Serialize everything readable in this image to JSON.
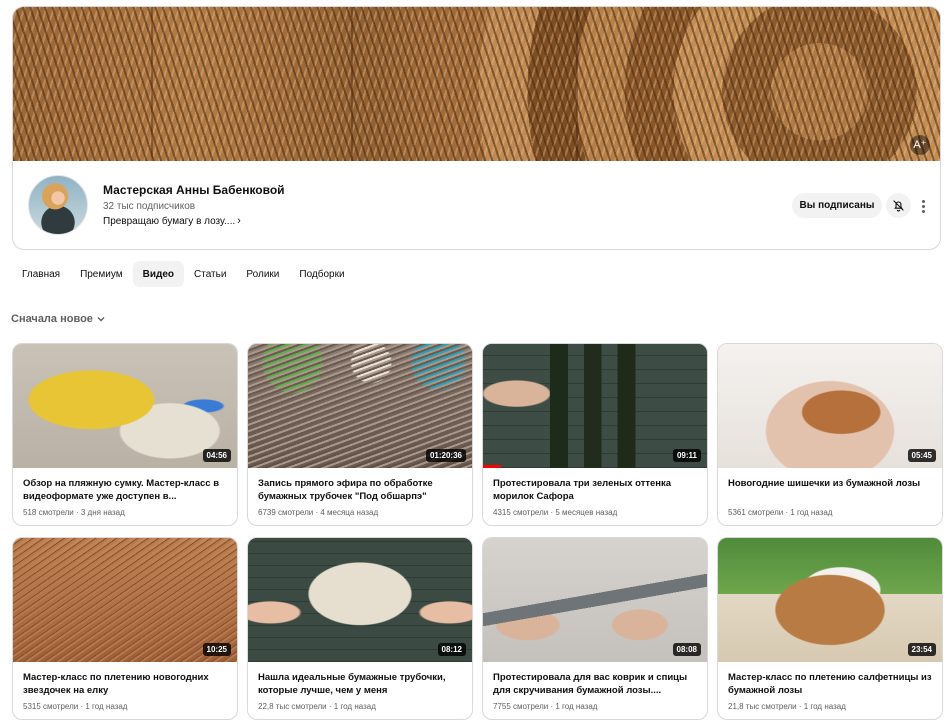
{
  "channel": {
    "name": "Мастерская Анны Бабенковой",
    "subscribers": "32 тыс подписчиков",
    "description": "Превращаю бумагу в лозу....",
    "subscribed_label": "Вы подписаны"
  },
  "tabs": [
    {
      "label": "Главная",
      "active": false
    },
    {
      "label": "Премиум",
      "active": false
    },
    {
      "label": "Видео",
      "active": true
    },
    {
      "label": "Статьи",
      "active": false
    },
    {
      "label": "Ролики",
      "active": false
    },
    {
      "label": "Подборки",
      "active": false
    }
  ],
  "sort": {
    "label": "Сначала новое"
  },
  "videos": [
    {
      "title": "Обзор на пляжную сумку. Мастер-класс в видеоформате уже доступен в...",
      "meta": "518 смотрели · 3 дня назад",
      "duration": "04:56",
      "watched": 0
    },
    {
      "title": "Запись прямого эфира по обработке бумажных трубочек \"Под обшарпэ\"",
      "meta": "6739 смотрели · 4 месяца назад",
      "duration": "01:20:36",
      "watched": 0
    },
    {
      "title": "Протестировала три зеленых оттенка морилок Сафора",
      "meta": "4315 смотрели · 5 месяцев назад",
      "duration": "09:11",
      "watched": 0.08
    },
    {
      "title": "Новогодние шишечки из бумажной лозы",
      "meta": "5361 смотрели · 1 год назад",
      "duration": "05:45",
      "watched": 0
    },
    {
      "title": "Мастер-класс по плетению новогодних звездочек на елку",
      "meta": "5315 смотрели · 1 год назад",
      "duration": "10:25",
      "watched": 0
    },
    {
      "title": "Нашла идеальные бумажные трубочки, которые лучше, чем у меня",
      "meta": "22,8 тыс смотрели · 1 год назад",
      "duration": "08:12",
      "watched": 0
    },
    {
      "title": "Протестировала для вас коврик и спицы для скручивания бумажной лозы....",
      "meta": "7755 смотрели · 1 год назад",
      "duration": "08:08",
      "watched": 0
    },
    {
      "title": "Мастер-класс по плетению салфетницы из бумажной лозы",
      "meta": "21,8 тыс смотрели · 1 год назад",
      "duration": "23:54",
      "watched": 0
    }
  ]
}
